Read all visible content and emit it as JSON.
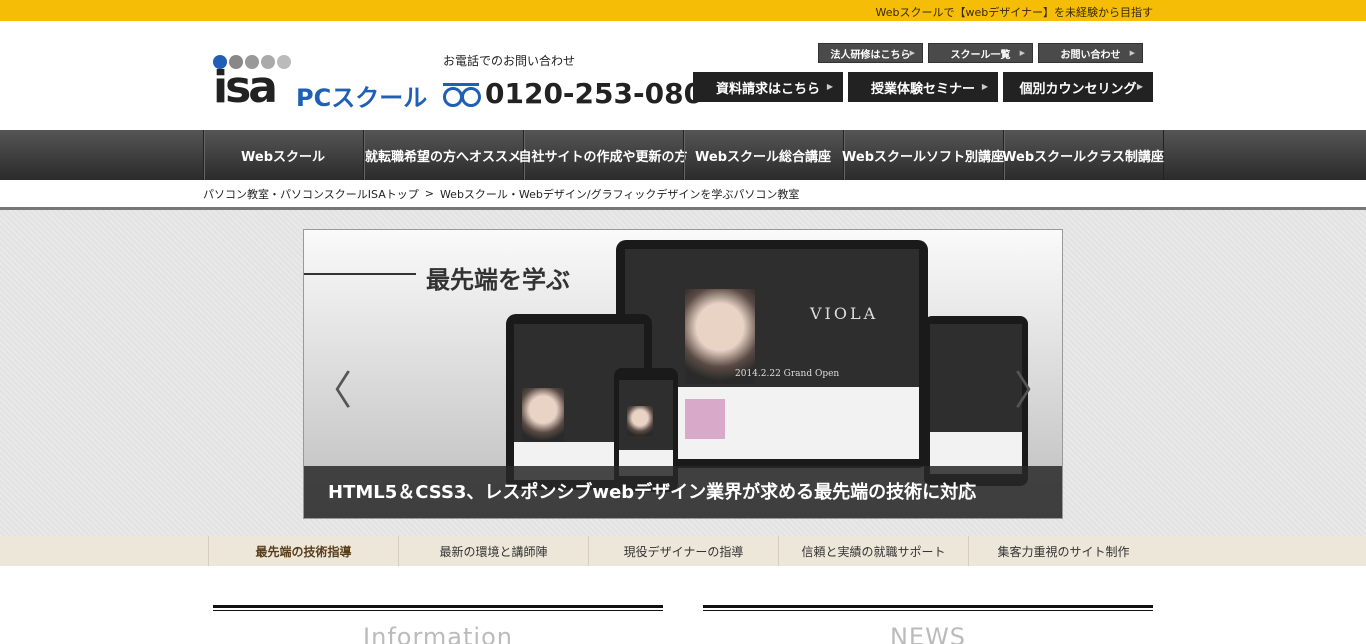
{
  "topbar": {
    "tagline": "Webスクールで【webデザイナー】を未経験から目指す",
    "color": "#f5bd06"
  },
  "logo": {
    "wordmark": "isa",
    "sub": "PCスクール",
    "accent": "#1f5fb5"
  },
  "tel": {
    "label": "お電話でのお問い合わせ",
    "number": "0120-253-080"
  },
  "small_buttons": [
    {
      "label": "法人研修はこちら"
    },
    {
      "label": "スクール一覧"
    },
    {
      "label": "お問い合わせ"
    }
  ],
  "big_buttons": [
    {
      "label": "資料請求はこちら"
    },
    {
      "label": "授業体験セミナー"
    },
    {
      "label": "個別カウンセリング"
    }
  ],
  "gnav": [
    {
      "label": "Webスクール"
    },
    {
      "label": "就転職希望の方へオススメ"
    },
    {
      "label": "自社サイトの作成や更新の方"
    },
    {
      "label": "Webスクール総合講座"
    },
    {
      "label": "Webスクールソフト別講座"
    },
    {
      "label": "Webスクールクラス制講座"
    }
  ],
  "breadcrumb": {
    "home": "パソコン教室・パソコンスクールISAトップ",
    "separator": ">",
    "current": "Webスクール・Webデザイン/グラフィックデザインを学ぶパソコン教室"
  },
  "slider": {
    "headline": "最先端を学ぶ",
    "caption": "HTML5＆CSS3、レスポンシブwebデザイン業界が求める最先端の技術に対応",
    "prev_glyph": "〈",
    "next_glyph": "〉",
    "device_brand": "VIOLA",
    "device_date": "2014.2.22 Grand Open"
  },
  "features": [
    {
      "label": "最先端の技術指導",
      "active": true
    },
    {
      "label": "最新の環境と講師陣"
    },
    {
      "label": "現役デザイナーの指導"
    },
    {
      "label": "信頼と実績の就職サポート"
    },
    {
      "label": "集客力重視のサイト制作"
    }
  ],
  "sections": {
    "left_title": "Information",
    "right_title": "NEWS"
  }
}
